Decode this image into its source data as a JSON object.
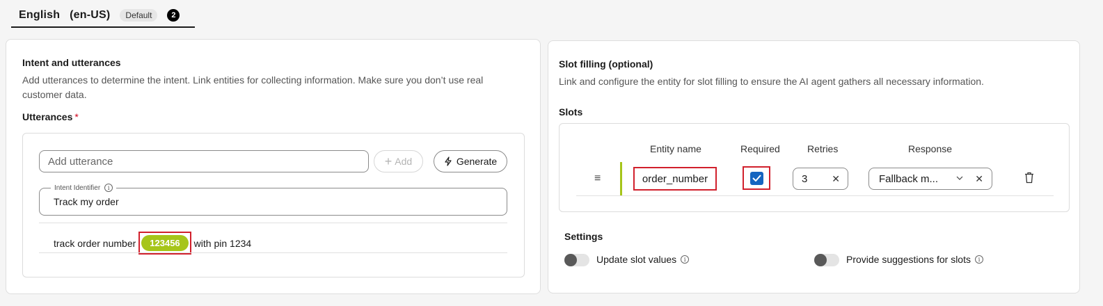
{
  "language_tab": {
    "title": "English   (en-US)",
    "badge": "Default",
    "count": "2"
  },
  "intent_section": {
    "title": "Intent and utterances",
    "description": "Add utterances to determine the intent. Link entities for collecting information. Make sure you don’t use real customer data.",
    "utterances_label": "Utterances",
    "required_mark": "*",
    "add_placeholder": "Add utterance",
    "add_button": "Add",
    "generate_button": "Generate",
    "intent_identifier_label": "Intent Identifier",
    "intent_identifier_value": "Track my order",
    "utterance_row": {
      "before": "track order number",
      "entity": "123456",
      "after": "with pin 1234"
    }
  },
  "slot_section": {
    "title": "Slot filling (optional)",
    "description": "Link and configure the entity for slot filling to ensure the AI agent gathers all necessary information.",
    "slots_label": "Slots",
    "columns": {
      "entity_name": "Entity name",
      "required": "Required",
      "retries": "Retries",
      "response": "Response"
    },
    "slot_row": {
      "entity_name": "order_number",
      "required": true,
      "retries": "3",
      "response": "Fallback m..."
    },
    "settings_title": "Settings",
    "update_slot_values_label": "Update slot values",
    "update_slot_values_on": false,
    "provide_suggestions_label": "Provide suggestions for slots",
    "provide_suggestions_on": false
  },
  "colors": {
    "entity_chip": "#a6c51a",
    "highlight_border": "#d1202c",
    "checkbox": "#1565c0"
  }
}
